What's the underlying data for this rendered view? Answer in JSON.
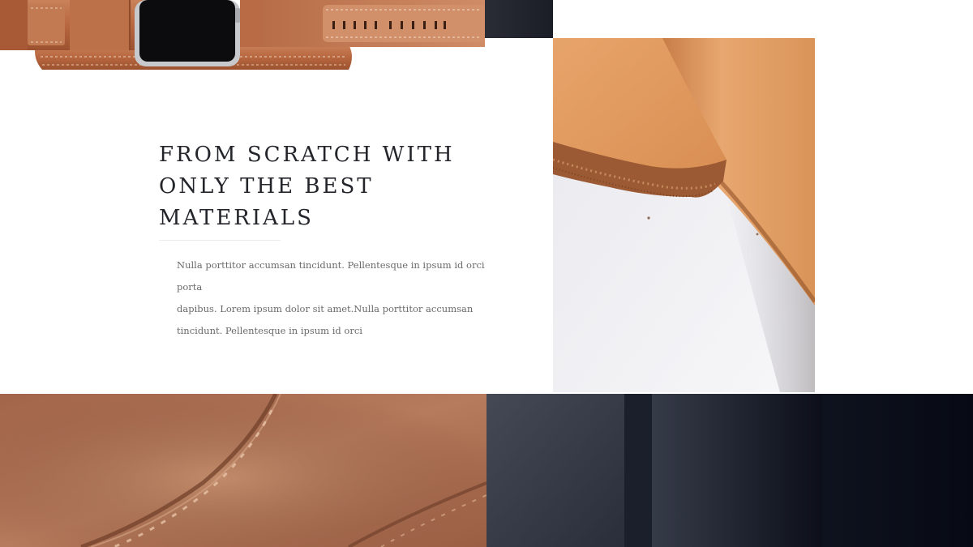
{
  "feature": {
    "heading_line_1": "FROM SCRATCH WITH",
    "heading_line_2": "ONLY THE BEST",
    "heading_line_3": "MATERIALS",
    "paragraph_line_1": "Nulla porttitor accumsan tincidunt. Pellentesque in ipsum id orci porta",
    "paragraph_line_2": "dapibus. Lorem ipsum dolor sit amet.Nulla porttitor accumsan",
    "paragraph_line_3": "tincidunt. Pellentesque in ipsum id orci"
  },
  "colors": {
    "leather": "#b8673f",
    "dark_panel": "#1a1e2a",
    "heading_text": "#23252b",
    "body_text": "#6a6a6a"
  }
}
